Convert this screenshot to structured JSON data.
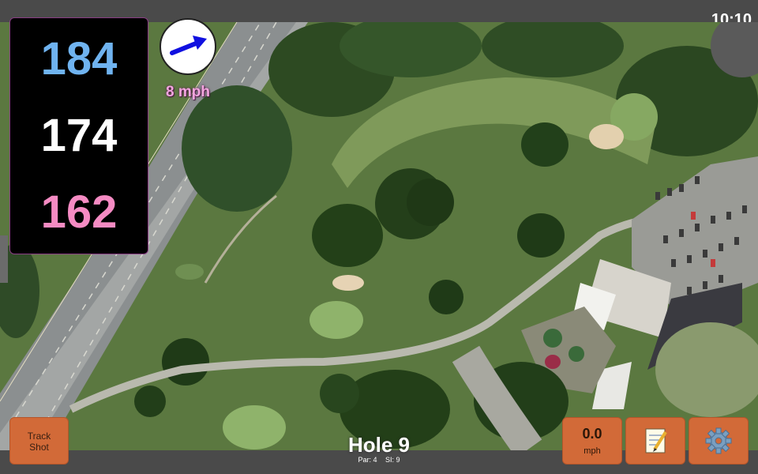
{
  "status": {
    "clock": "10:10"
  },
  "yardages": {
    "back": "184",
    "middle": "174",
    "front": "162"
  },
  "wind": {
    "speed_label": "8 mph",
    "arrow_icon": "wind-direction-arrow-icon",
    "arrow_color": "#1010e0"
  },
  "hole": {
    "title": "Hole 9",
    "par_label": "Par: 4",
    "si_label": "SI: 9"
  },
  "buttons": {
    "track_line1": "Track",
    "track_line2": "Shot",
    "speed_value": "0.0",
    "speed_unit": "mph",
    "notes_icon": "notepad-icon",
    "settings_icon": "gear-icon"
  },
  "colors": {
    "button": "#d26a38",
    "back_yardage": "#6fb3f0",
    "front_yardage": "#f58bc3",
    "wind_text": "#f4a6e0"
  }
}
